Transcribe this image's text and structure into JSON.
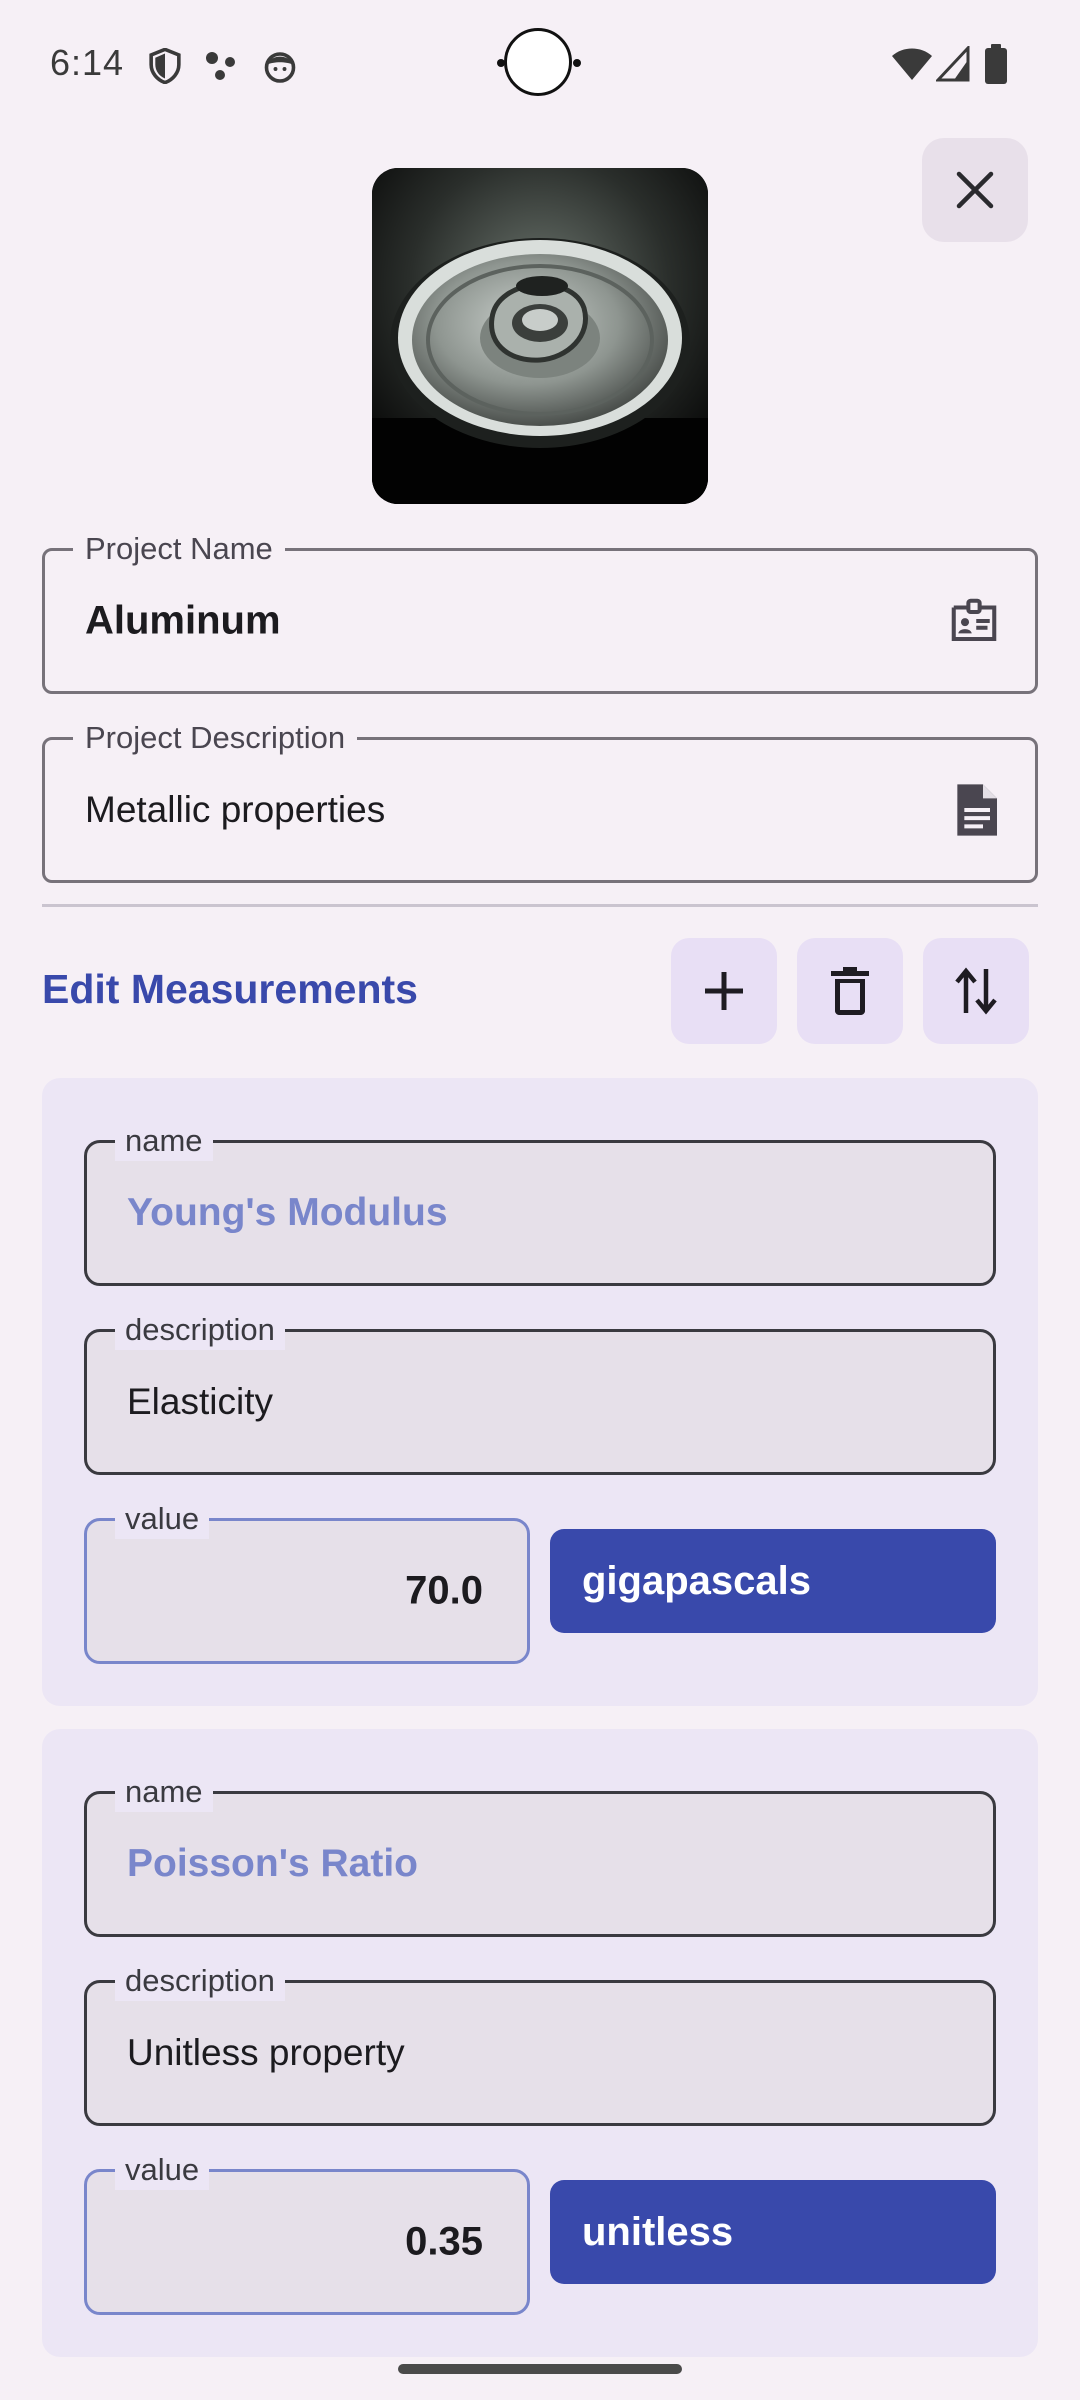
{
  "status_bar": {
    "time": "6:14",
    "icons": [
      "shield-icon",
      "dots-icon",
      "face-icon",
      "wifi-icon",
      "signal-icon",
      "battery-icon"
    ]
  },
  "header": {
    "close_icon": "close-icon",
    "project_image_alt": "pull-tab can image"
  },
  "project": {
    "name_label": "Project Name",
    "name_value": "Aluminum",
    "name_icon": "badge-icon",
    "description_label": "Project Description",
    "description_value": "Metallic properties",
    "description_icon": "document-icon"
  },
  "measurements_section": {
    "title": "Edit Measurements",
    "add_icon": "plus-icon",
    "delete_icon": "trash-icon",
    "sort_icon": "swap-vertical-icon"
  },
  "measurements": [
    {
      "name_label": "name",
      "name": "Young's Modulus",
      "description_label": "description",
      "description": "Elasticity",
      "value_label": "value",
      "value": "70.0",
      "unit": "gigapascals"
    },
    {
      "name_label": "name",
      "name": "Poisson's Ratio",
      "description_label": "description",
      "description": "Unitless property",
      "value_label": "value",
      "value": "0.35",
      "unit": "unitless"
    }
  ],
  "colors": {
    "accent": "#3949ab",
    "name_text": "#7986cb",
    "card_bg": "#ece6f5",
    "background": "#f6f0f6"
  }
}
